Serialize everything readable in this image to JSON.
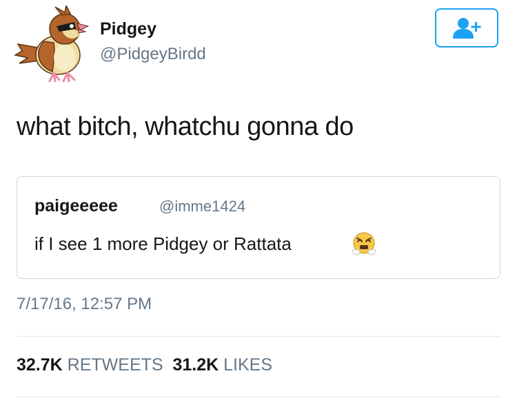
{
  "author": {
    "display_name": "Pidgey",
    "handle": "@PidgeyBirdd",
    "avatar_icon": "pidgey-bird-avatar"
  },
  "follow_button": {
    "icon": "add-user-icon"
  },
  "tweet": {
    "text": "what bitch, whatchu gonna do"
  },
  "quoted_tweet": {
    "display_name": "paigeeeee",
    "handle": "@imme1424",
    "text": "if I see 1 more Pidgey or Rattata",
    "emoji": "steam-from-nose-face-emoji"
  },
  "timestamp": "7/17/16, 12:57 PM",
  "stats": {
    "retweets_count": "32.7K",
    "retweets_label": "RETWEETS",
    "likes_count": "31.2K",
    "likes_label": "LIKES"
  },
  "colors": {
    "accent": "#1da1f2",
    "secondary_text": "#657786",
    "border": "#ccd6dd"
  }
}
